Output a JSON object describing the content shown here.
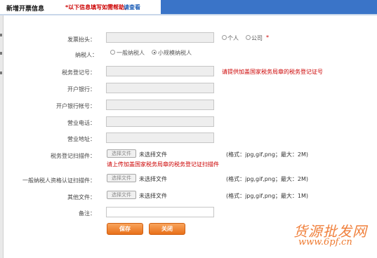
{
  "header": {
    "title": "新增开票信息",
    "hint": "*以下信息填写如需帮助，",
    "help_link": "请查看"
  },
  "form": {
    "invoice_title_label": "发票抬头：",
    "invoice_title_options": [
      "个人",
      "公司"
    ],
    "invoice_title_required": "*",
    "taxpayer_label": "纳税人：",
    "taxpayer_options": [
      "一般纳税人",
      "小规模纳税人"
    ],
    "taxpayer_selected": "小规模纳税人",
    "tax_reg_label": "税务登记号：",
    "tax_reg_note": "请提供加盖国家税务局章的税务登记证号",
    "bank_label": "开户银行：",
    "bank_account_label": "开户银行帐号：",
    "phone_label": "营业电话：",
    "address_label": "营业地址：",
    "tax_cert_label": "税务登记扫描件：",
    "tax_cert_note": "请上传加盖国家税务局章的税务登记证扫描件",
    "general_cert_label": "一般纳税人资格认证扫描件：",
    "other_label": "其他文件：",
    "remark_label": "备注：",
    "remark_value": ""
  },
  "file": {
    "button": "选择文件",
    "status": "未选择文件",
    "format_2m": "(格式：jpg,gif,png；最大：2M)",
    "format_1m": "(格式：jpg,gif,png；最大：1M)"
  },
  "buttons": {
    "save": "保存",
    "close": "关闭"
  },
  "watermark": {
    "cn": "货源批发网",
    "url": "www.6pf.cn"
  },
  "colors": {
    "accent": "#e8701a",
    "error": "#cc0000",
    "link": "#1f5fb8",
    "header_strip": "#3a74c8"
  }
}
